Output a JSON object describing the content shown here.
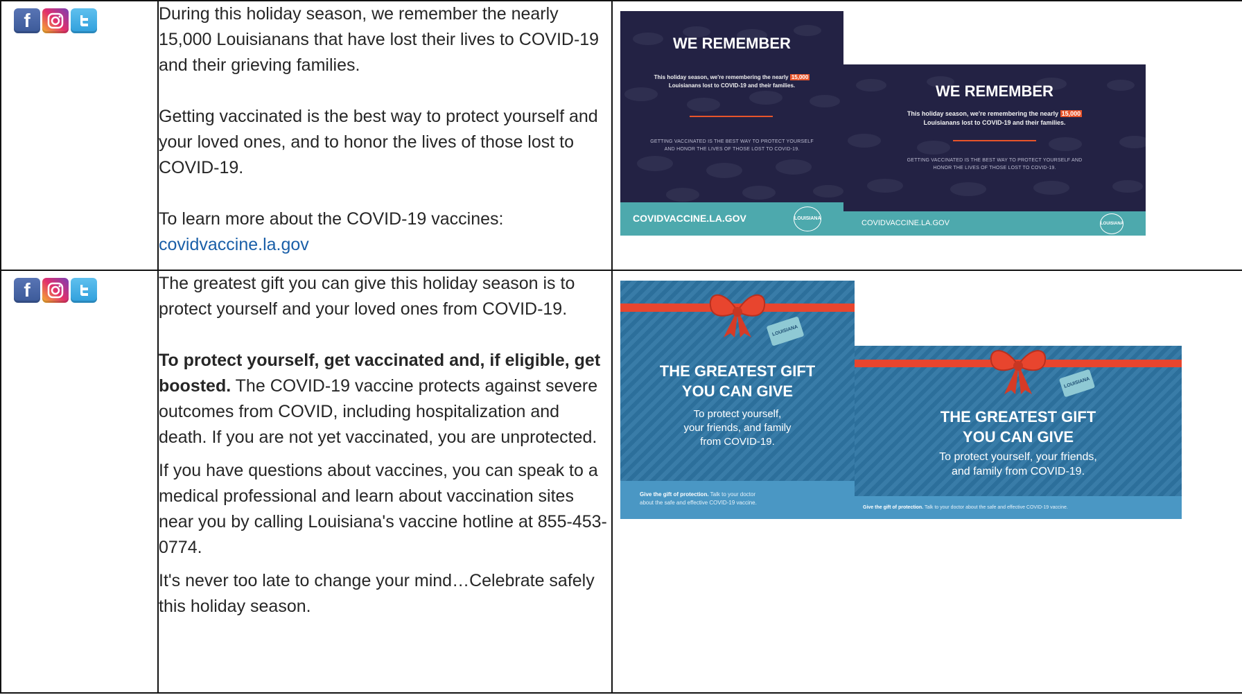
{
  "rows": [
    {
      "icons": [
        "facebook-icon",
        "instagram-icon",
        "twitter-icon"
      ],
      "paragraphs": [
        "During this holiday season, we remember the nearly 15,000 Louisianans that have lost their lives to COVID-19 and their grieving families.",
        "Getting vaccinated is the best way to protect yourself and your loved ones, and to honor the lives of those lost to COVID-19.",
        "To learn more about the COVID-19 vaccines:"
      ],
      "link": "covidvaccine.la.gov",
      "images": {
        "square": {
          "title": "WE REMEMBER",
          "line1a": "This holiday season, we're remembering the nearly",
          "line1_highlight": "15,000",
          "line2": "Louisianans lost to COVID-19 and their families.",
          "small1": "GETTING VACCINATED IS THE BEST WAY TO PROTECT YOURSELF",
          "small2": "AND HONOR THE LIVES OF THOSE LOST TO COVID-19.",
          "url": "COVIDVACCINE.LA.GOV",
          "logo": "LOUISIANA"
        },
        "wide": {
          "title": "WE REMEMBER",
          "line1a": "This holiday season, we're remembering the nearly",
          "line1_highlight": "15,000",
          "line2": "Louisianans lost to COVID-19 and their families.",
          "small1": "GETTING VACCINATED IS THE BEST WAY TO PROTECT YOURSELF AND",
          "small2": "HONOR THE LIVES OF THOSE LOST TO COVID-19.",
          "url": "COVIDVACCINE.LA.GOV",
          "logo": "LOUISIANA"
        }
      }
    },
    {
      "icons": [
        "facebook-icon",
        "instagram-icon",
        "twitter-icon"
      ],
      "p1": "The greatest gift you can give this holiday season is to protect yourself and your loved ones from COVID-19.",
      "p2_bold": "To protect yourself, get vaccinated and, if eligible, get boosted.",
      "p2_rest": " The COVID-19 vaccine protects against severe outcomes from COVID, including hospitalization and death. If you are not yet vaccinated, you are unprotected.",
      "p3": "If you have questions about vaccines, you can speak to a medical professional and learn about vaccination sites near you by calling Louisiana's vaccine hotline at 855-453-0774.",
      "p4": "It's never too late to change your mind…Celebrate safely this holiday season.",
      "images": {
        "square": {
          "title1": "THE GREATEST GIFT",
          "title2": "YOU CAN GIVE",
          "body1": "To protect yourself,",
          "body2": "your friends, and family",
          "body3": "from COVID-19.",
          "foot_bold": "Give the gift of protection.",
          "foot1": " Talk to your doctor",
          "foot2": "about the safe and effective COVID-19 vaccine.",
          "tag": "LOUISIANA"
        },
        "wide": {
          "title1": "THE GREATEST GIFT",
          "title2": "YOU CAN GIVE",
          "body1": "To protect yourself, your friends,",
          "body2": "and family from COVID-19.",
          "foot_bold": "Give the gift of protection.",
          "foot1": " Talk to your doctor about the safe and effective COVID-19 vaccine.",
          "tag": "LOUISIANA"
        }
      }
    }
  ],
  "colors": {
    "remember_bg": "#232244",
    "accent_orange": "#e8542a",
    "teal_footer": "#4da9ad",
    "gift_blue": "#2e75a3",
    "ribbon_red": "#e8452e",
    "link_blue": "#1a5fa8"
  }
}
